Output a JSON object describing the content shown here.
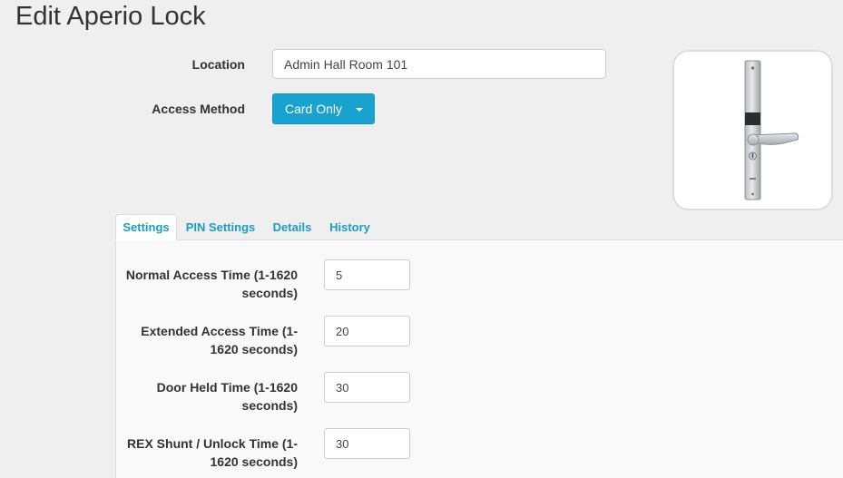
{
  "page": {
    "title": "Edit Aperio Lock"
  },
  "form": {
    "location_label": "Location",
    "location_value": "Admin Hall Room 101",
    "access_method_label": "Access Method",
    "access_method_value": "Card Only"
  },
  "lock_image": {
    "icon": "aperio-lock-handle-image"
  },
  "tabs": [
    {
      "label": "Settings",
      "active": true
    },
    {
      "label": "PIN Settings",
      "active": false
    },
    {
      "label": "Details",
      "active": false
    },
    {
      "label": "History",
      "active": false
    }
  ],
  "settings": [
    {
      "label_line1": "Normal Access Time (1-1620",
      "label_line2": "seconds)",
      "value": "5"
    },
    {
      "label_line1": "Extended Access Time (1-",
      "label_line2": "1620 seconds)",
      "value": "20"
    },
    {
      "label_line1": "Door Held Time (1-1620",
      "label_line2": "seconds)",
      "value": "30"
    },
    {
      "label_line1": "REX Shunt / Unlock Time (1-",
      "label_line2": "1620 seconds)",
      "value": "30"
    }
  ],
  "colors": {
    "accent": "#17a2cf",
    "tab_text": "#1a9cc9",
    "background": "#efefef"
  }
}
